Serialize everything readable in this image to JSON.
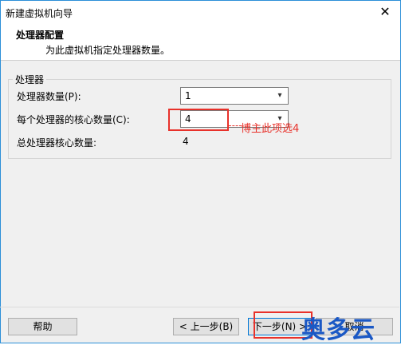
{
  "window": {
    "title": "新建虚拟机向导"
  },
  "header": {
    "title": "处理器配置",
    "subtitle": "为此虚拟机指定处理器数量。"
  },
  "group": {
    "legend": "处理器",
    "processor_count": {
      "label": "处理器数量(P):",
      "value": "1"
    },
    "cores_per_processor": {
      "label": "每个处理器的核心数量(C):",
      "value": "4"
    },
    "total_cores": {
      "label": "总处理器核心数量:",
      "value": "4"
    }
  },
  "annotation": {
    "text": "博主此项选4"
  },
  "buttons": {
    "help": "帮助",
    "back": "< 上一步(B)",
    "next": "下一步(N) >",
    "cancel": "取消"
  },
  "watermark": {
    "text": "奥多云"
  },
  "colors": {
    "annotation": "#e8312a",
    "watermark": "#1a58c5",
    "focus": "#0078d7"
  }
}
